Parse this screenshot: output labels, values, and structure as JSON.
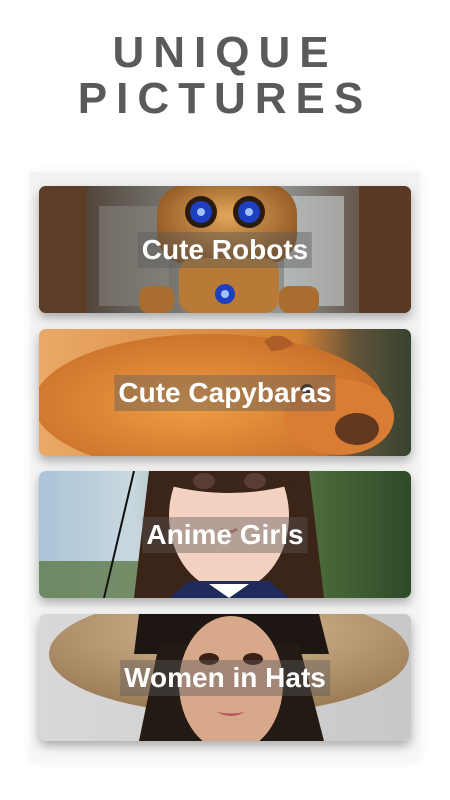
{
  "header": {
    "title_line1": "UNIQUE",
    "title_line2": "PICTURES"
  },
  "categories": [
    {
      "label": "Cute Robots",
      "image": "robot-image"
    },
    {
      "label": "Cute Capybaras",
      "image": "capybara-image"
    },
    {
      "label": "Anime Girls",
      "image": "anime-girl-image"
    },
    {
      "label": "Women in Hats",
      "image": "woman-in-hat-image"
    }
  ],
  "colors": {
    "title": "#5a5a5a",
    "label_text": "#ffffff",
    "label_backdrop": "rgba(90,90,90,0.42)"
  }
}
